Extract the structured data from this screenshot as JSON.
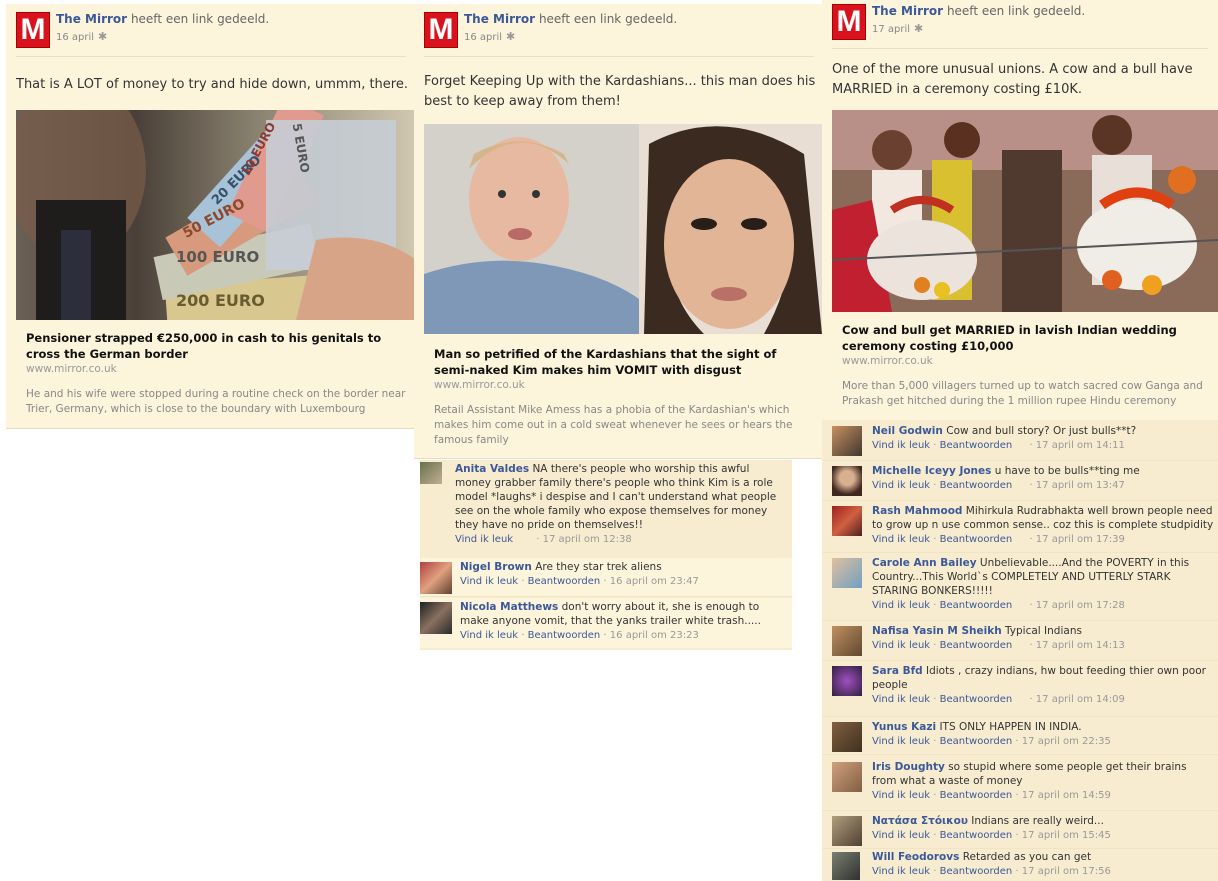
{
  "posts": [
    {
      "author": "The Mirror",
      "action": "heeft een link gedeeld.",
      "date": "16 april",
      "text": "That is A LOT of money to try and hide down, ummm, there.",
      "link_title": "Pensioner strapped €250,000 in cash to his genitals to cross the German border",
      "link_domain": "www.mirror.co.uk",
      "link_desc": "He and his wife were stopped during a routine check on the border near Trier, Germany, which is close to the boundary with Luxembourg",
      "banknotes": [
        "200 EURO",
        "100 EURO",
        "50 EURO",
        "20 EURO",
        "10 EURO",
        "5 EURO"
      ]
    },
    {
      "author": "The Mirror",
      "action": "heeft een link gedeeld.",
      "date": "16 april",
      "text": "Forget Keeping Up with the Kardashians... this man does his best to keep away from them!",
      "link_title": "Man so petrified of the Kardashians that the sight of semi-naked Kim makes him VOMIT with disgust",
      "link_domain": "www.mirror.co.uk",
      "link_desc": "Retail Assistant Mike Amess has a phobia of the Kardashian's which makes him come out in a cold sweat whenever he sees or hears the famous family",
      "comments": [
        {
          "name": "Anita Valdes",
          "text": "NA there's people who worship this awful money grabber family there's people who think Kim is a role model *laughs* i despise and I can't understand what people see on the whole family who expose themselves for money they have no pride on themselves!!",
          "like": "Vind ik leuk",
          "reply": "",
          "time": "17 april om 12:38"
        },
        {
          "name": "Nigel Brown",
          "text": "Are they star trek aliens",
          "like": "Vind ik leuk",
          "reply": "Beantwoorden",
          "time": "16 april om 23:47"
        },
        {
          "name": "Nicola Matthews",
          "text": "don't worry about it, she is enough to make anyone vomit, that the yanks trailer white trash.....",
          "like": "Vind ik leuk",
          "reply": "Beantwoorden",
          "time": "16 april om 23:23"
        }
      ]
    },
    {
      "author": "The Mirror",
      "action": "heeft een link gedeeld.",
      "date": "17 april",
      "text": "One of the more unusual unions. A cow and a bull have MARRIED in a ceremony costing £10K.",
      "link_title": "Cow and bull get MARRIED in lavish Indian wedding ceremony costing £10,000",
      "link_domain": "www.mirror.co.uk",
      "link_desc": "More than 5,000 villagers turned up to watch sacred cow Ganga and Prakash get hitched during the 1 million rupee Hindu ceremony",
      "comments": [
        {
          "name": "Neil Godwin",
          "text": "Cow and bull story? Or just bulls**t?",
          "like": "Vind ik leuk",
          "reply": "Beantwoorden",
          "time": "17 april om 14:11"
        },
        {
          "name": "Michelle Iceyy Jones",
          "text": "u have to be bulls**ting me",
          "like": "Vind ik leuk",
          "reply": "Beantwoorden",
          "time": "17 april om 13:47"
        },
        {
          "name": "Rash Mahmood",
          "text": "Mihirkula Rudrabhakta well brown people need to grow up n use common sense.. coz this is complete studpidity",
          "like": "Vind ik leuk",
          "reply": "Beantwoorden",
          "time": "17 april om 17:39"
        },
        {
          "name": "Carole Ann Bailey",
          "text": "Unbelievable....And the POVERTY in this Country...This World`s COMPLETELY AND UTTERLY STARK STARING BONKERS!!!!!",
          "like": "Vind ik leuk",
          "reply": "Beantwoorden",
          "time": "17 april om 17:28"
        },
        {
          "name": "Nafisa Yasin M Sheikh",
          "text": "Typical Indians",
          "like": "Vind ik leuk",
          "reply": "Beantwoorden",
          "time": "17 april om 14:13"
        },
        {
          "name": "Sara Bfd",
          "text": "Idiots , crazy indians, hw bout feeding thier own poor people",
          "like": "Vind ik leuk",
          "reply": "Beantwoorden",
          "time": "17 april om 14:09"
        },
        {
          "name": "Yunus Kazi",
          "text": "ITS ONLY HAPPEN IN INDIA.",
          "like": "Vind ik leuk",
          "reply": "Beantwoorden",
          "time": "17 april om 22:35"
        },
        {
          "name": "Iris Doughty",
          "text": "so stupid where some people get their brains from what a waste of money",
          "like": "Vind ik leuk",
          "reply": "Beantwoorden",
          "time": "17 april om 14:59"
        },
        {
          "name": "Νατάσα Στόικου",
          "text": "Indians are really weird...",
          "like": "Vind ik leuk",
          "reply": "Beantwoorden",
          "time": "17 april om 15:45"
        },
        {
          "name": "Will Feodorovs",
          "text": "Retarded as you can get",
          "like": "Vind ik leuk",
          "reply": "Beantwoorden",
          "time": "17 april om 17:56"
        }
      ]
    }
  ],
  "colors": {
    "brand": "#d8131e",
    "link": "#3b5998",
    "background": "#fdf4dc"
  }
}
